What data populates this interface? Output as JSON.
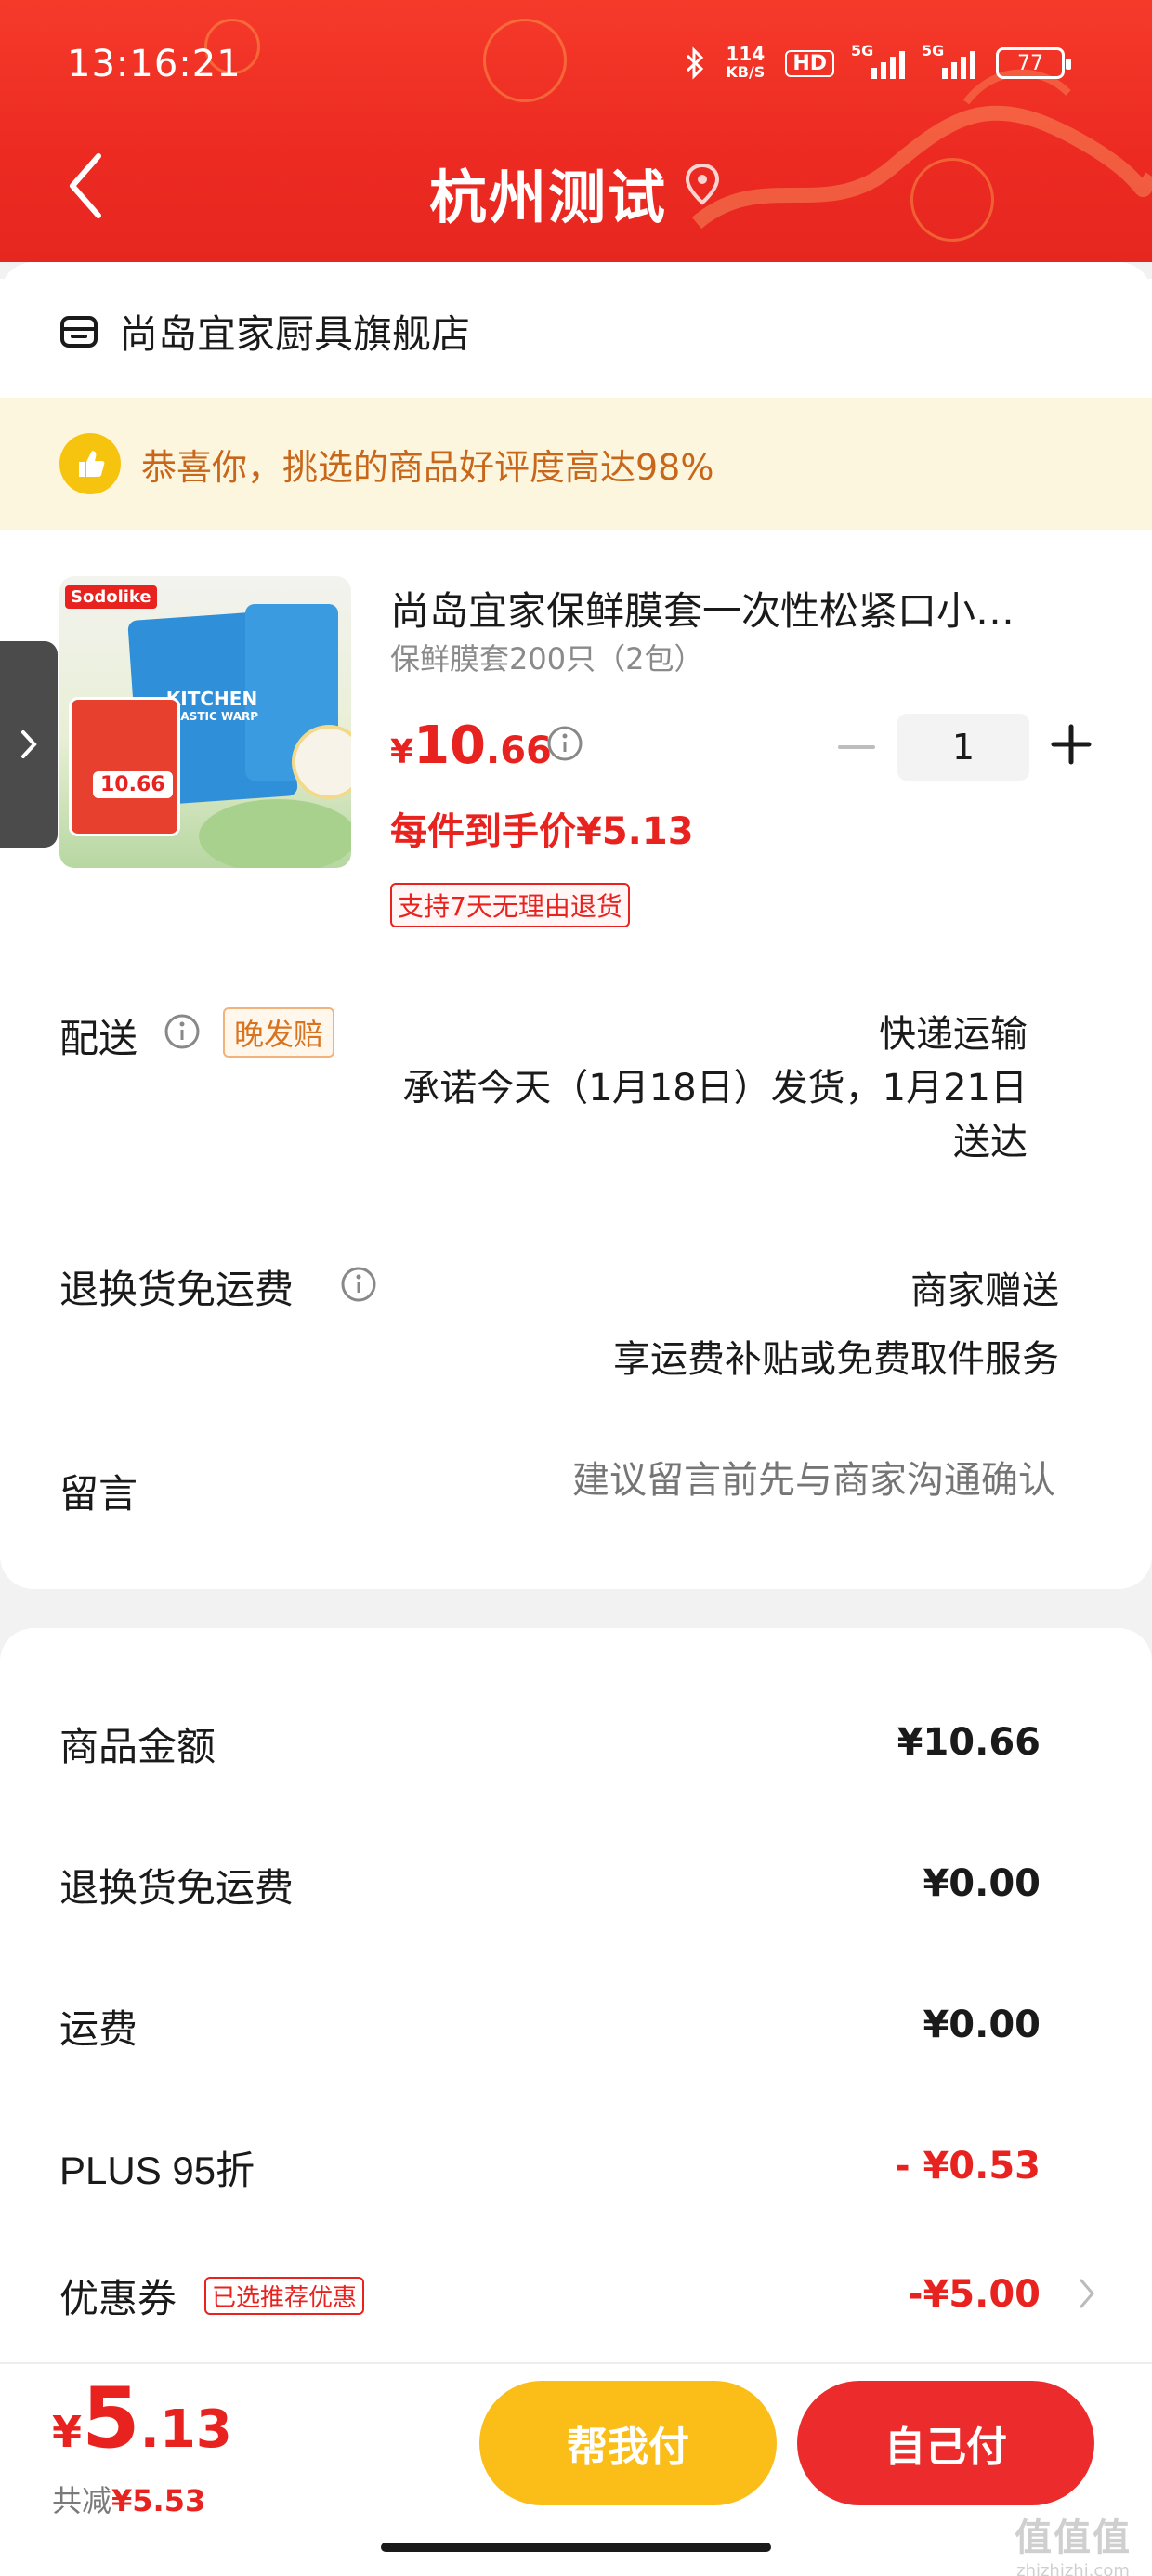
{
  "status_bar": {
    "time": "13:16:21",
    "net_speed_value": "114",
    "net_speed_unit": "KB/S",
    "hd": "HD",
    "sig1": "5G",
    "sig2": "5G",
    "battery": "77"
  },
  "nav": {
    "title": "杭州测试"
  },
  "shop": {
    "name": "尚岛宜家厨具旗舰店"
  },
  "banner": {
    "text": "恭喜你，挑选的商品好评度高达98%"
  },
  "product": {
    "brand": "Sodolike",
    "package_line1": "KITCHEN",
    "package_line2": "PLASTIC WARP",
    "promo_price": "10.66",
    "title": "尚岛宜家保鲜膜套一次性松紧口小…",
    "spec": "保鲜膜套200只（2包）",
    "price_currency": "¥",
    "price_int": "10",
    "price_dec": ".66",
    "unit_price": "每件到手价¥5.13",
    "return_tag": "支持7天无理由退货",
    "quantity": "1"
  },
  "delivery": {
    "label": "配送",
    "tag": "晚发赔",
    "method": "快递运输",
    "promise_line1": "承诺今天（1月18日）发货，1月21日",
    "promise_line2": "送达"
  },
  "free_return": {
    "label": "退换货免运费",
    "value_line1": "商家赠送",
    "value_line2": "享运费补贴或免费取件服务"
  },
  "message": {
    "label": "留言",
    "placeholder": "建议留言前先与商家沟通确认"
  },
  "summary": {
    "goods_label": "商品金额",
    "goods_value": "¥10.66",
    "return_label": "退换货免运费",
    "return_value": "¥0.00",
    "shipping_label": "运费",
    "shipping_value": "¥0.00",
    "plus_label": "PLUS 95折",
    "plus_value": "- ¥0.53",
    "coupon_label": "优惠券",
    "coupon_tag": "已选推荐优惠",
    "coupon_value": "-¥5.00"
  },
  "footer": {
    "total_currency": "¥",
    "total_int": "5",
    "total_dec": ".13",
    "saved_label": "共减",
    "saved_value": "¥5.53",
    "help_pay": "帮我付",
    "self_pay": "自己付"
  },
  "watermark": {
    "line1": "值值值",
    "line2": "zhizhizhi.com"
  },
  "colors": {
    "primary_red": "#e8231f",
    "header_red": "#ec2a22",
    "help_button": "#fbbd18",
    "self_button": "#ec2b2d",
    "banner_bg": "#fdf6df",
    "banner_text": "#c8661a"
  }
}
